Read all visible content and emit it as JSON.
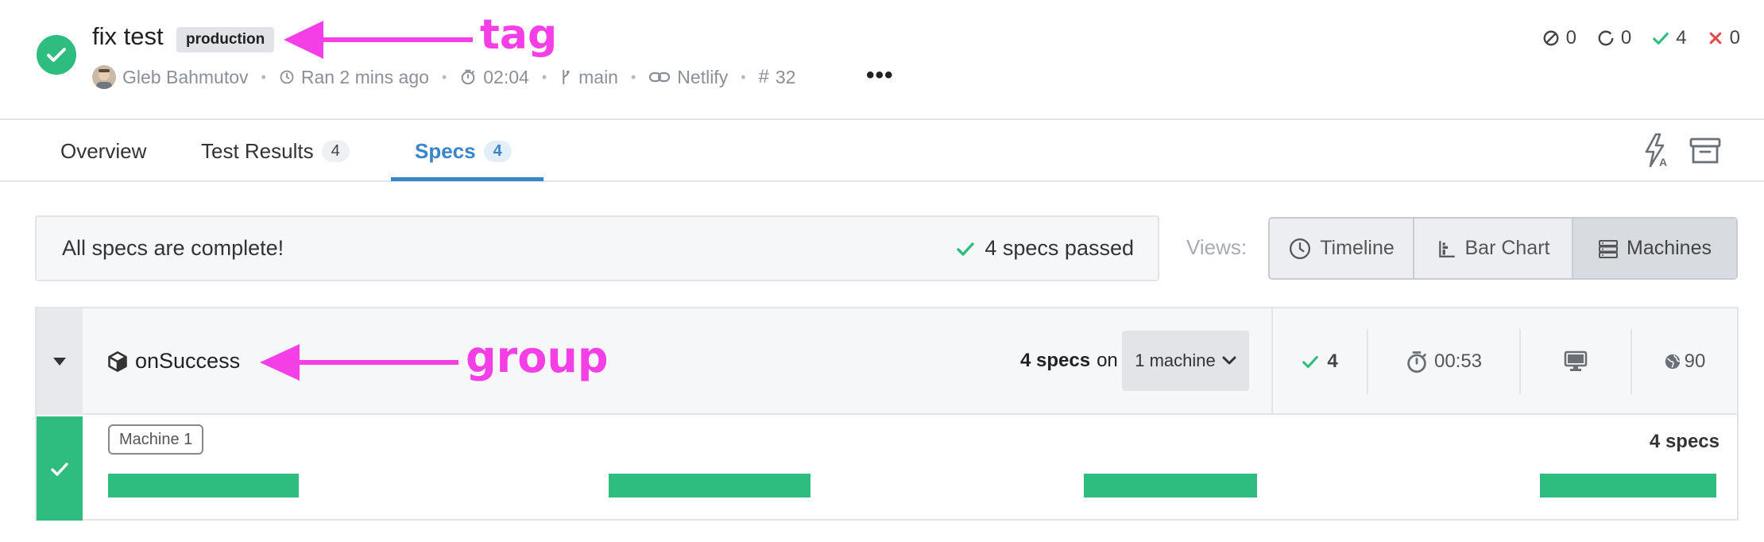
{
  "run": {
    "title": "fix test",
    "tag": "production",
    "author": "Gleb Bahmutov",
    "ran": "Ran 2 mins ago",
    "duration": "02:04",
    "branch": "main",
    "ci": "Netlify",
    "run_number": "32",
    "more": "•••"
  },
  "counts": {
    "skipped": "0",
    "pending": "0",
    "passed": "4",
    "failed": "0"
  },
  "annotations": {
    "tag": "tag",
    "group": "group"
  },
  "tabs": [
    {
      "label": "Overview"
    },
    {
      "label": "Test Results",
      "count": "4"
    },
    {
      "label": "Specs",
      "count": "4"
    }
  ],
  "status": {
    "message": "All specs are complete!",
    "passed": "4 specs passed"
  },
  "views": {
    "label": "Views:",
    "options": [
      "Timeline",
      "Bar Chart",
      "Machines"
    ],
    "selected": "Machines"
  },
  "group": {
    "name": "onSuccess",
    "specs_count": "4 specs",
    "on": "on",
    "machine_select": "1 machine",
    "passed": "4",
    "duration": "00:53",
    "browser_version": "90"
  },
  "machine": {
    "label": "Machine 1",
    "specs": "4 specs",
    "status": "passed",
    "spec_bars": 4
  },
  "colors": {
    "pass": "#2ebc7f",
    "fail": "#e34b4b",
    "accent": "#3a84c9",
    "annotation": "#f53fe6"
  }
}
